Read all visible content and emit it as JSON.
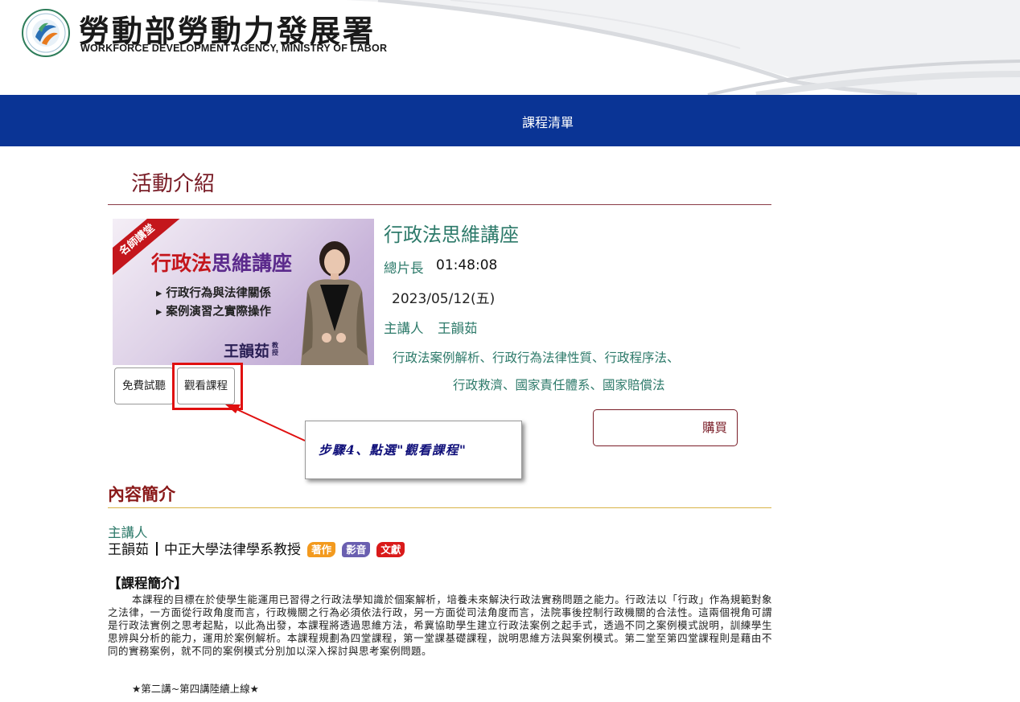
{
  "header": {
    "org_name_zh": "勞動部勞動力發展署",
    "org_name_en": "WORKFORCE DEVELOPMENT AGENCY, MINISTRY OF LABOR"
  },
  "nav": {
    "course_list": "課程清單"
  },
  "page": {
    "section_title": "活動介紹"
  },
  "banner": {
    "badge": "名師講堂",
    "title_part1": "行政法",
    "title_part2": "思維講座",
    "point1": "▸ 行政行為與法律關係",
    "point2": "▸ 案例演習之實際操作",
    "lecturer": "王韻茹",
    "rank": "教授"
  },
  "buttons": {
    "free_trial": "免費試聽",
    "watch_course": "觀看課程",
    "buy": "購買"
  },
  "course": {
    "title": "行政法思維講座",
    "duration_label": "總片長",
    "duration": "01:48:08",
    "date": "2023/05/12(五)",
    "lecturer_label": "主講人",
    "lecturer": "王韻茹",
    "topics_line1": "行政法案例解析、行政行為法律性質、行政程序法、",
    "topics_line2": "行政救濟、國家責任體系、國家賠償法"
  },
  "callout": {
    "text": "步驟4、點選\"觀看課程\""
  },
  "intro": {
    "heading": "內容簡介",
    "lecturer_label": "主講人",
    "lecturer_name": "王韻茹",
    "lecturer_title": "中正大學法律學系教授",
    "tags": [
      "著作",
      "影音",
      "文獻"
    ],
    "desc_heading": "【課程簡介】",
    "desc_body": "本課程的目標在於使學生能運用已習得之行政法學知識於個案解析，培養未來解決行政法實務問題之能力。行政法以「行政」作為規範對象之法律，一方面從行政角度而言，行政機關之行為必須依法行政，另一方面從司法角度而言，法院事後控制行政機關的合法性。這兩個視角可謂是行政法實例之思考起點，以此為出發，本課程將透過思維方法，希冀協助學生建立行政法案例之起手式，透過不同之案例模式說明，訓練學生思辨與分析的能力，運用於案例解析。本課程規劃為四堂課程，第一堂課基礎課程，說明思維方法與案例模式。第二堂至第四堂課程則是藉由不同的實務案例，就不同的案例模式分別加以深入探討與思考案例問題。",
    "desc_note": "★第二講~第四講陸續上線★"
  },
  "colors": {
    "navbar": "#0a3495",
    "section_title": "#7a1e28",
    "teal_text": "#2d7a6a",
    "highlight": "#e01010",
    "callout_text": "#10107a"
  }
}
